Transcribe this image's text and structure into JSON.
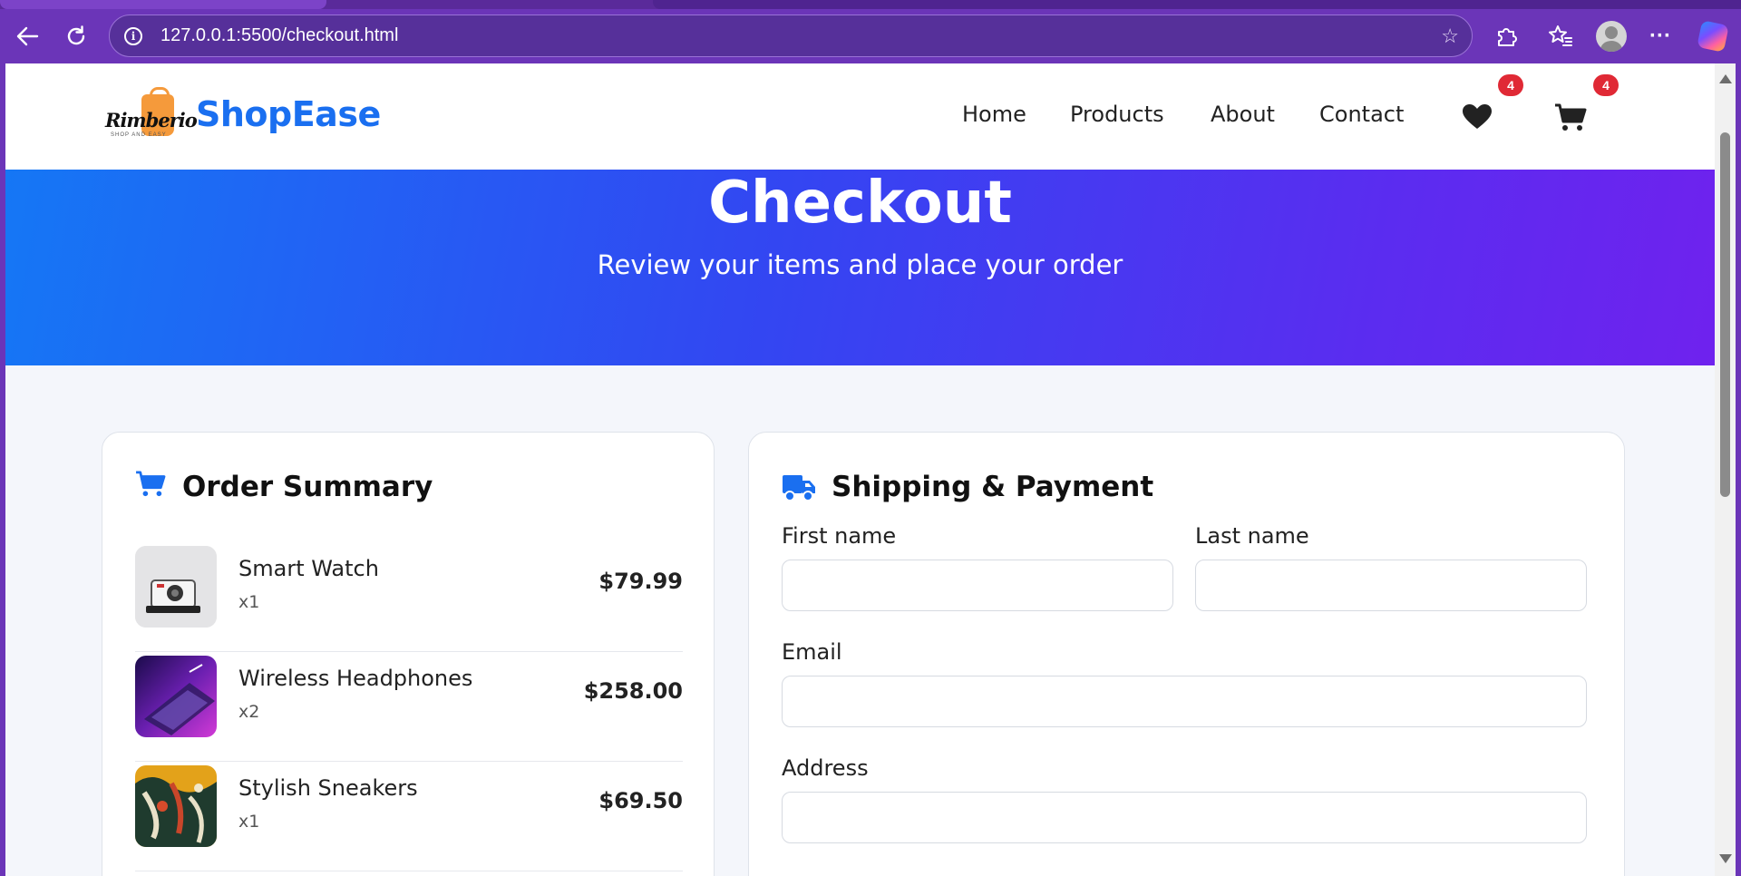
{
  "browser": {
    "url": "127.0.0.1:5500/checkout.html"
  },
  "navbar": {
    "logo_text": "Rimberio",
    "logo_tagline": "SHOP AND EASY",
    "brand": "ShopEase",
    "links": [
      "Home",
      "Products",
      "About",
      "Contact"
    ],
    "wishlist_count": "4",
    "cart_count": "4"
  },
  "hero": {
    "title": "Checkout",
    "subtitle": "Review your items and place your order"
  },
  "order_summary": {
    "title": "Order Summary",
    "items": [
      {
        "name": "Smart Watch",
        "qty": "x1",
        "price": "$79.99"
      },
      {
        "name": "Wireless Headphones",
        "qty": "x2",
        "price": "$258.00"
      },
      {
        "name": "Stylish Sneakers",
        "qty": "x1",
        "price": "$69.50"
      }
    ]
  },
  "shipping": {
    "title": "Shipping & Payment",
    "first_name_label": "First name",
    "last_name_label": "Last name",
    "email_label": "Email",
    "address_label": "Address",
    "first_name_value": "",
    "last_name_value": "",
    "email_value": "",
    "address_value": ""
  },
  "colors": {
    "brand_blue": "#1a6ff0",
    "badge_red": "#e02935",
    "hero_start": "#1577f5",
    "hero_end": "#6f22ee"
  }
}
